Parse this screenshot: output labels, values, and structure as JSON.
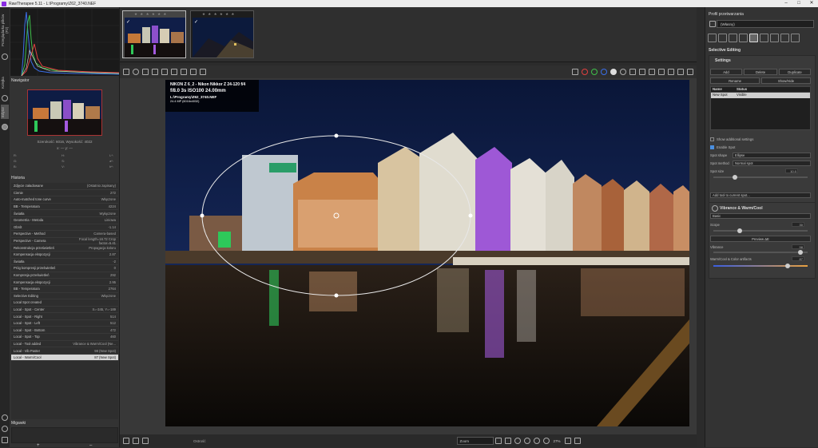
{
  "window": {
    "title": "RawTherapee 5.11 - L:\\Programy\\Z62_3740.NEF",
    "controls": [
      "–",
      "□",
      "✕"
    ]
  },
  "vertical_tabs": [
    "Przeglądarka plików (F2)",
    "Kolejka",
    "Edytor"
  ],
  "navigator": {
    "title": "Nawigator",
    "info": "Szerokość: 6016, Wysokość: 4022",
    "coords": "x: — y: —",
    "rgb": [
      {
        "a": "R:",
        "b": "H:",
        "c": "L*:"
      },
      {
        "a": "G:",
        "b": "S:",
        "c": "a*:"
      },
      {
        "a": "B:",
        "b": "V:",
        "c": "b*:"
      }
    ]
  },
  "history": {
    "title": "Historia",
    "rows": [
      {
        "label": "Zdjęcie załadowane",
        "value": "(Ostatnio zapisany)"
      },
      {
        "label": "Cienie",
        "value": "272"
      },
      {
        "label": "Auto-matched tone curve",
        "value": "Włączone"
      },
      {
        "label": "BB - Temperatura",
        "value": "4224"
      },
      {
        "label": "Światła",
        "value": "Wyłączone"
      },
      {
        "label": "Geometria - Metoda",
        "value": "Liniowa"
      },
      {
        "label": "Obrót",
        "value": "-1.14"
      },
      {
        "label": "Perspective - Method",
        "value": "Camera-based"
      },
      {
        "label": "Perspective - Camera",
        "value": "Focal length=16.72 Crop factor=5.41"
      },
      {
        "label": "Rekonstrukcja prześwietleń",
        "value": "Propagacja koloru"
      },
      {
        "label": "Kompensacja ekspozycji",
        "value": "2.87"
      },
      {
        "label": "Światła",
        "value": "-2"
      },
      {
        "label": "Próg kompresji prześwietleń",
        "value": "0"
      },
      {
        "label": "Kompresja prześwietleń",
        "value": "292"
      },
      {
        "label": "Kompensacja ekspozycji",
        "value": "2.95"
      },
      {
        "label": "BB - Temperatura",
        "value": "2764"
      },
      {
        "label": "Selective Editing",
        "value": "Włączone"
      },
      {
        "label": "Local Spot created",
        "value": ""
      },
      {
        "label": "Local - Spot - Center",
        "value": "X=-345, Y=-189"
      },
      {
        "label": "Local - Spot - Right",
        "value": "514"
      },
      {
        "label": "Local - Spot - Left",
        "value": "512"
      },
      {
        "label": "Local - Spot - Bottom",
        "value": "472"
      },
      {
        "label": "Local - Spot - Top",
        "value": "460"
      },
      {
        "label": "Local - Tool added",
        "value": "Vibrance & Warm/Cool (Ne..."
      },
      {
        "label": "Local - Vib Paster",
        "value": "98 (New Spot)"
      },
      {
        "label": "Local - Warm/Cool",
        "value": "87 (New Spot)"
      }
    ],
    "selected_index": 25
  },
  "bookmarks": {
    "title": "Migawki",
    "add": "+",
    "remove": "–"
  },
  "filmstrip": {
    "stars": "★ ★ ★ ★ ★ ★"
  },
  "image_info": {
    "camera": "NIKON Z 6_2  -  Nikon Nikkor Z 24-120 f/4",
    "exposure": "f/8.0  3s  ISO100  24.00mm",
    "path": "L:\\Programy\\Z62_3740.NEF",
    "size": "24.4 MP (6016x4032)"
  },
  "bottom_toolbar": {
    "label": "Ostrość",
    "zoom": "Zoom",
    "zoom_percent": "27%"
  },
  "right_panel": {
    "profile_title": "Profil przetwarzania",
    "profile_value": "(Własny)",
    "section_title": "Selective Editing",
    "settings_title": "Settings",
    "buttons": {
      "add": "Add",
      "delete": "Delete",
      "duplicate": "Duplicate",
      "rename": "Rename",
      "showhide": "Show/Hide"
    },
    "table": {
      "col_name": "Name",
      "col_status": "Status",
      "row_name": "New Spot",
      "row_status": "Visible"
    },
    "show_additional": "Show additional settings",
    "enable_spot": "Enable Spot",
    "spot_shape_label": "Spot shape",
    "spot_shape": "Ellipse",
    "spot_method_label": "Spot method",
    "spot_method": "Normal spot",
    "spot_size_label": "Spot size",
    "spot_size": "10.0",
    "add_tool": "Add tool to current spot...",
    "vib_title": "Vibrance & Warm/Cool",
    "vib_mode": "Basic",
    "scope_label": "Scope",
    "scope": "30",
    "preview_btn": "Preview ΔE",
    "vibrance_label": "Vibrance",
    "vibrance": "98",
    "warm_label": "Warm/Cool & Color artifacts",
    "warm": "87"
  }
}
